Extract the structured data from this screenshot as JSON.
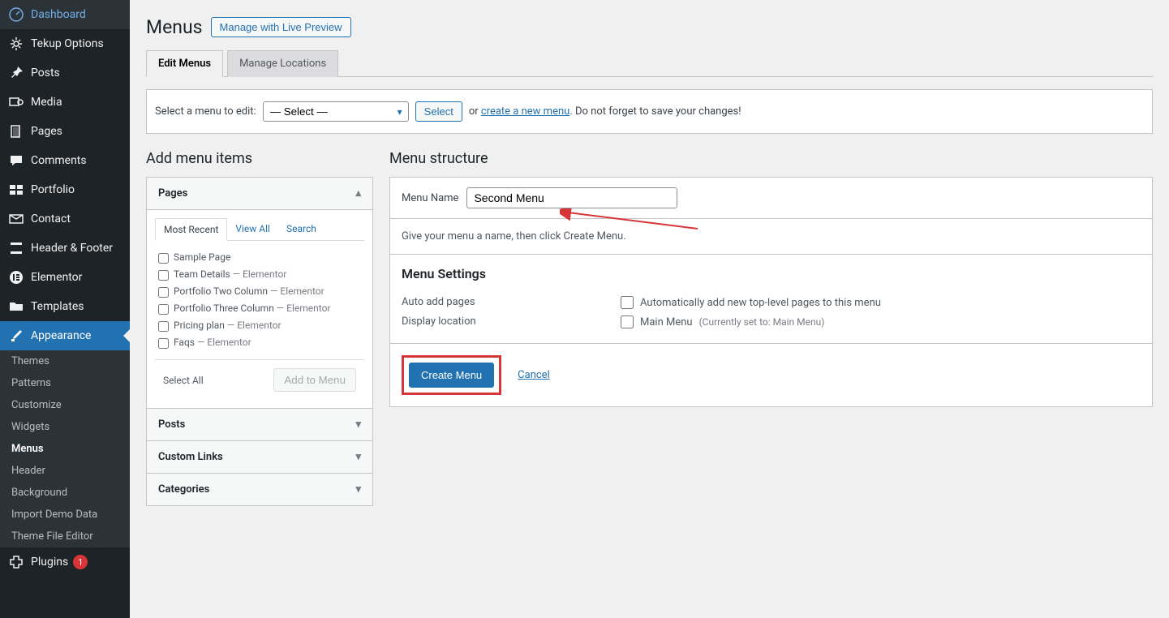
{
  "sidebar": {
    "items": [
      {
        "icon": "dashboard",
        "label": "Dashboard"
      },
      {
        "icon": "gear",
        "label": "Tekup Options"
      },
      {
        "icon": "pin",
        "label": "Posts"
      },
      {
        "icon": "media",
        "label": "Media"
      },
      {
        "icon": "page",
        "label": "Pages"
      },
      {
        "icon": "comment",
        "label": "Comments"
      },
      {
        "icon": "portfolio",
        "label": "Portfolio"
      },
      {
        "icon": "mail",
        "label": "Contact"
      },
      {
        "icon": "layout",
        "label": "Header & Footer"
      },
      {
        "icon": "elementor",
        "label": "Elementor"
      },
      {
        "icon": "folder",
        "label": "Templates"
      },
      {
        "icon": "brush",
        "label": "Appearance"
      }
    ],
    "appearance_sub": [
      "Themes",
      "Patterns",
      "Customize",
      "Widgets",
      "Menus",
      "Header",
      "Background",
      "Import Demo Data",
      "Theme File Editor"
    ],
    "plugins": {
      "label": "Plugins",
      "badge": "1"
    }
  },
  "header": {
    "title": "Menus",
    "preview_btn": "Manage with Live Preview"
  },
  "tabs": {
    "edit": "Edit Menus",
    "locations": "Manage Locations"
  },
  "edit_bar": {
    "label": "Select a menu to edit:",
    "select_value": "— Select —",
    "select_btn": "Select",
    "or_text": "or",
    "create_link": "create a new menu",
    "save_note": ". Do not forget to save your changes!"
  },
  "add_items": {
    "title": "Add menu items",
    "pages": {
      "header": "Pages",
      "tabs": {
        "recent": "Most Recent",
        "all": "View All",
        "search": "Search"
      },
      "items": [
        {
          "label": "Sample Page",
          "sub": ""
        },
        {
          "label": "Team Details",
          "sub": " — Elementor"
        },
        {
          "label": "Portfolio Two Column",
          "sub": " — Elementor",
          "wrap": true
        },
        {
          "label": "Portfolio Three Column",
          "sub": " — Elementor",
          "wrap": true
        },
        {
          "label": "Pricing plan",
          "sub": " — Elementor"
        },
        {
          "label": "Faqs",
          "sub": " — Elementor"
        }
      ],
      "select_all": "Select All",
      "add_btn": "Add to Menu"
    },
    "collapsed": [
      "Posts",
      "Custom Links",
      "Categories"
    ]
  },
  "structure": {
    "title": "Menu structure",
    "name_label": "Menu Name",
    "name_value": "Second Menu",
    "help_text": "Give your menu a name, then click Create Menu.",
    "settings": {
      "title": "Menu Settings",
      "auto_label": "Auto add pages",
      "auto_value": "Automatically add new top-level pages to this menu",
      "display_label": "Display location",
      "display_value": "Main Menu",
      "display_note": "(Currently set to: Main Menu)"
    },
    "create_btn": "Create Menu",
    "cancel_link": "Cancel"
  }
}
